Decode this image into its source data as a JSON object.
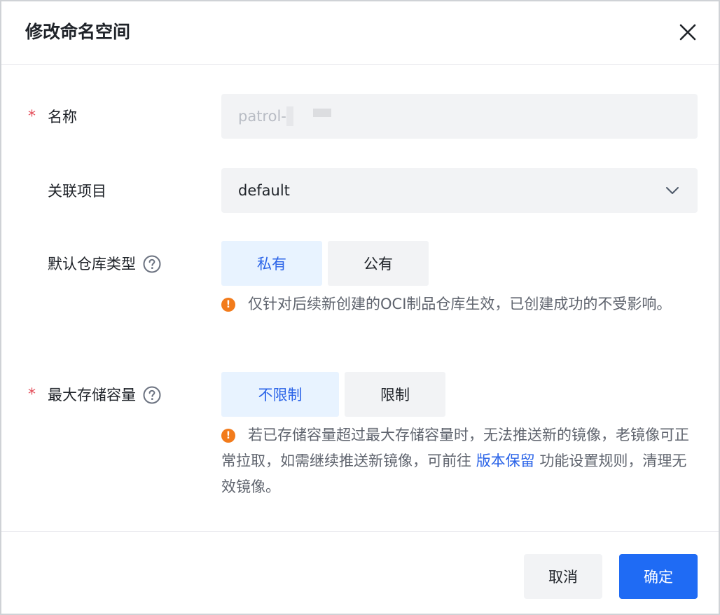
{
  "dialog": {
    "title": "修改命名空间"
  },
  "form": {
    "name": {
      "required_mark": "*",
      "label": "名称",
      "value": "patrol-"
    },
    "project": {
      "label": "关联项目",
      "selected": "default"
    },
    "repo_type": {
      "label": "默认仓库类型",
      "options": [
        "私有",
        "公有"
      ],
      "selected_index": 0,
      "hint": "仅针对后续新创建的OCI制品仓库生效，已创建成功的不受影响。"
    },
    "max_storage": {
      "required_mark": "*",
      "label": "最大存储容量",
      "options": [
        "不限制",
        "限制"
      ],
      "selected_index": 0,
      "hint_before": "若已存储容量超过最大存储容量时，无法推送新的镜像，老镜像可正常拉取，如需继续推送新镜像，可前往 ",
      "hint_link": "版本保留",
      "hint_after": " 功能设置规则，清理无效镜像。"
    }
  },
  "footer": {
    "cancel_label": "取消",
    "ok_label": "确定"
  },
  "colors": {
    "primary": "#1f6bf4",
    "active_segment_bg": "#e8f3ff",
    "warning": "#f27b1b",
    "required": "#e34d59"
  },
  "icons": [
    "close-icon",
    "chevron-down-icon",
    "help-circle-icon",
    "warning-circle-icon"
  ]
}
